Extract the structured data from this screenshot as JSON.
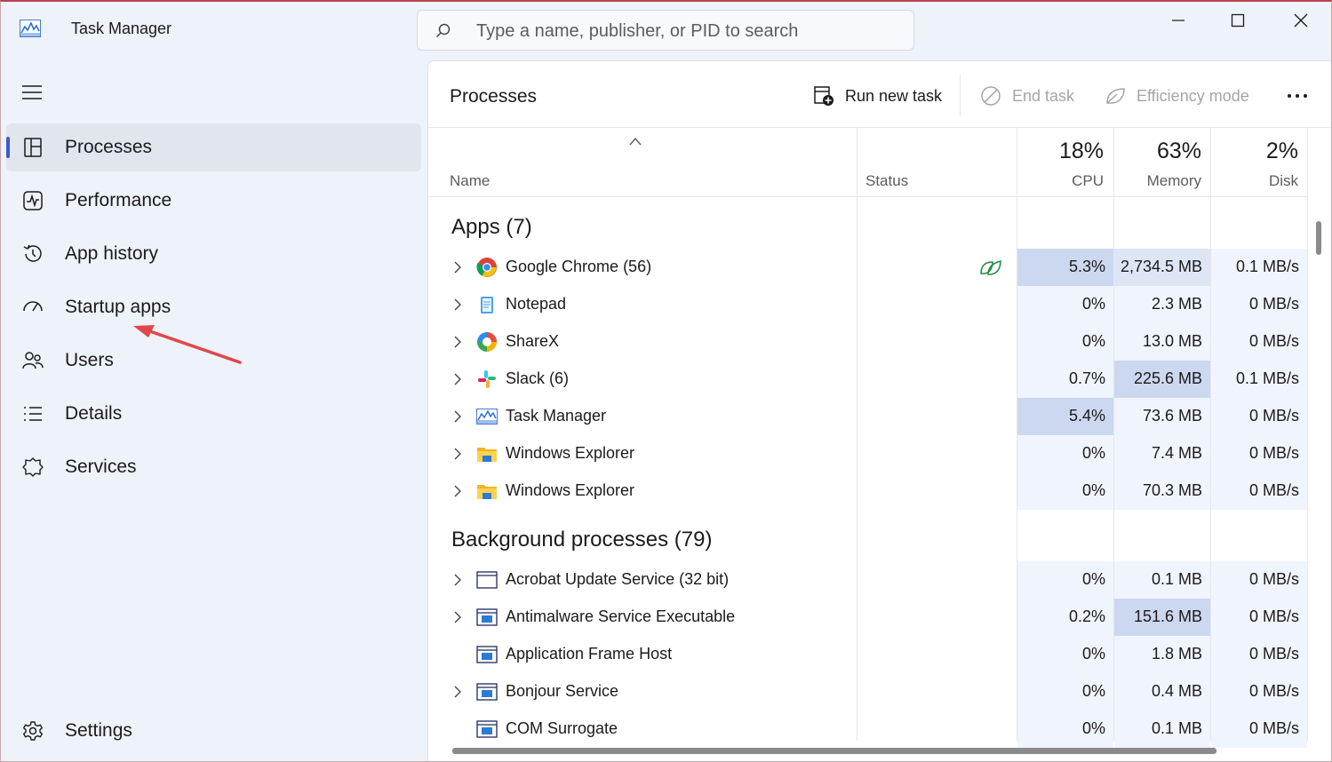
{
  "window": {
    "title": "Task Manager",
    "search_placeholder": "Type a name, publisher, or PID to search"
  },
  "sidebar": {
    "items": [
      {
        "label": "Processes",
        "icon": "processes-icon",
        "active": true
      },
      {
        "label": "Performance",
        "icon": "performance-icon"
      },
      {
        "label": "App history",
        "icon": "app-history-icon"
      },
      {
        "label": "Startup apps",
        "icon": "startup-apps-icon"
      },
      {
        "label": "Users",
        "icon": "users-icon"
      },
      {
        "label": "Details",
        "icon": "details-icon"
      },
      {
        "label": "Services",
        "icon": "services-icon"
      }
    ],
    "settings_label": "Settings"
  },
  "toolbar": {
    "title": "Processes",
    "run_new_task": "Run new task",
    "end_task": "End task",
    "efficiency_mode": "Efficiency mode"
  },
  "columns": {
    "name": "Name",
    "status": "Status",
    "cpu_pct": "18%",
    "cpu": "CPU",
    "memory_pct": "63%",
    "memory": "Memory",
    "disk_pct": "2%",
    "disk": "Disk"
  },
  "groups": {
    "apps": "Apps (7)",
    "background": "Background processes (79)"
  },
  "apps": [
    {
      "name": "Google Chrome (56)",
      "icon": "chrome-icon",
      "cpu": "5.3%",
      "memory": "2,734.5 MB",
      "disk": "0.1 MB/s",
      "expandable": true,
      "efficiency": true
    },
    {
      "name": "Notepad",
      "icon": "notepad-icon",
      "cpu": "0%",
      "memory": "2.3 MB",
      "disk": "0 MB/s",
      "expandable": true
    },
    {
      "name": "ShareX",
      "icon": "sharex-icon",
      "cpu": "0%",
      "memory": "13.0 MB",
      "disk": "0 MB/s",
      "expandable": true
    },
    {
      "name": "Slack (6)",
      "icon": "slack-icon",
      "cpu": "0.7%",
      "memory": "225.6 MB",
      "disk": "0.1 MB/s",
      "expandable": true
    },
    {
      "name": "Task Manager",
      "icon": "task-manager-icon",
      "cpu": "5.4%",
      "memory": "73.6 MB",
      "disk": "0 MB/s",
      "expandable": true
    },
    {
      "name": "Windows Explorer",
      "icon": "folder-icon",
      "cpu": "0%",
      "memory": "7.4 MB",
      "disk": "0 MB/s",
      "expandable": true
    },
    {
      "name": "Windows Explorer",
      "icon": "folder-icon",
      "cpu": "0%",
      "memory": "70.3 MB",
      "disk": "0 MB/s",
      "expandable": true
    }
  ],
  "background": [
    {
      "name": "Acrobat Update Service (32 bit)",
      "icon": "window-icon",
      "cpu": "0%",
      "memory": "0.1 MB",
      "disk": "0 MB/s",
      "expandable": true
    },
    {
      "name": "Antimalware Service Executable",
      "icon": "service-icon",
      "cpu": "0.2%",
      "memory": "151.6 MB",
      "disk": "0 MB/s",
      "expandable": true
    },
    {
      "name": "Application Frame Host",
      "icon": "service-icon",
      "cpu": "0%",
      "memory": "1.8 MB",
      "disk": "0 MB/s",
      "expandable": false
    },
    {
      "name": "Bonjour Service",
      "icon": "service-icon",
      "cpu": "0%",
      "memory": "0.4 MB",
      "disk": "0 MB/s",
      "expandable": true
    },
    {
      "name": "COM Surrogate",
      "icon": "service-icon",
      "cpu": "0%",
      "memory": "0.1 MB",
      "disk": "0 MB/s",
      "expandable": false
    }
  ],
  "colors": {
    "accent": "#3c5ac8",
    "heat_low": "#f0f4fc",
    "heat_mid": "#dee6f6",
    "heat_high": "#ccd8f0",
    "annotation_arrow": "#e0474c"
  }
}
